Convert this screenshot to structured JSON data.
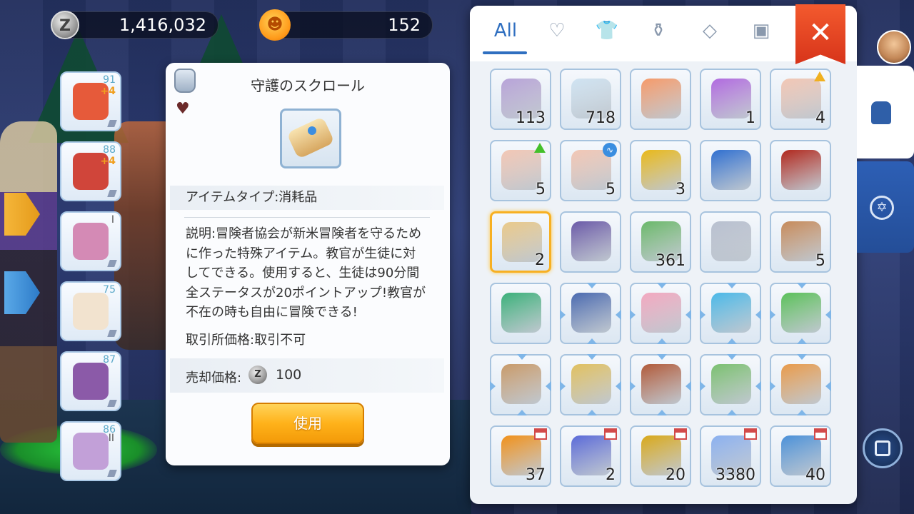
{
  "currency": {
    "zeny_icon": "Z",
    "zeny_amount": "1,416,032",
    "cat_amount": "152"
  },
  "equipment": [
    {
      "icon": "ring-icon",
      "num": "91",
      "plus": "+4",
      "color": "#e65a3a"
    },
    {
      "icon": "armor-icon",
      "num": "88",
      "plus": "+4",
      "color": "#d0453a"
    },
    {
      "icon": "gloves-icon",
      "num": "",
      "roman": "I",
      "color": "#d48ab5"
    },
    {
      "icon": "boots-icon",
      "num": "75",
      "color": "#f2e3cf"
    },
    {
      "icon": "gem-icon",
      "num": "87",
      "color": "#8b5aa8"
    },
    {
      "icon": "cape-icon",
      "num": "86",
      "roman": "II",
      "color": "#c2a0d8"
    }
  ],
  "detail": {
    "title": "守護のスクロール",
    "type_label": "アイテムタイプ:消耗品",
    "description": "説明:冒険者協会が新米冒険者を守るために作った特殊アイテム。教官が生徒に対してできる。使用すると、生徒は90分間全ステータスが20ポイントアップ!教官が不在の時も自由に冒険できる!",
    "trade_price": "取引所価格:取引不可",
    "sell_label": "売却価格:",
    "sell_coin": "Z",
    "sell_value": "100",
    "use_button": "使用"
  },
  "inventory": {
    "tabs": [
      {
        "label": "All",
        "icon": "all-tab"
      },
      {
        "label": "♡",
        "icon": "heart-icon"
      },
      {
        "label": "👕",
        "icon": "armor-tab-icon"
      },
      {
        "label": "⚱",
        "icon": "potion-tab-icon"
      },
      {
        "label": "◇",
        "icon": "diamond-icon"
      },
      {
        "label": "▣",
        "icon": "card-tab-icon"
      }
    ],
    "close_label": "✕",
    "rows": [
      [
        {
          "name": "butterfly-wing",
          "qty": "113",
          "color": "#b7a3d8"
        },
        {
          "name": "fly-wing",
          "qty": "718",
          "color": "#cfe3f2"
        },
        {
          "name": "potion-bottle",
          "qty": "",
          "color": "#f59a6a"
        },
        {
          "name": "purple-wing",
          "qty": "1",
          "color": "#b06ae0"
        },
        {
          "name": "chalice",
          "qty": "4",
          "color": "#f2c7b5",
          "badge": "tri"
        }
      ],
      [
        {
          "name": "chalice-green",
          "qty": "5",
          "color": "#f2c7b5",
          "badge": "tri-g"
        },
        {
          "name": "chalice-blue",
          "qty": "5",
          "color": "#f2c7b5",
          "badge": "circ"
        },
        {
          "name": "gold-card",
          "qty": "3",
          "color": "#e8b81a"
        },
        {
          "name": "blue-shield-card",
          "qty": "",
          "color": "#2f6fd0"
        },
        {
          "name": "red-card",
          "qty": "",
          "color": "#b0281e"
        }
      ],
      [
        {
          "name": "guardian-scroll",
          "qty": "2",
          "color": "#e9c98a",
          "selected": true
        },
        {
          "name": "purple-book",
          "qty": "",
          "color": "#6a5aa8"
        },
        {
          "name": "green-leaf",
          "qty": "361",
          "color": "#6ab86a"
        },
        {
          "name": "silver-sword-coin",
          "qty": "",
          "color": "#b8c0d0"
        },
        {
          "name": "pouch",
          "qty": "5",
          "color": "#c68a5a"
        }
      ],
      [
        {
          "name": "green-backpack",
          "qty": "",
          "color": "#3ab07a"
        },
        {
          "name": "blue-book",
          "qty": "",
          "color": "#4a6ab0",
          "arrows": true
        },
        {
          "name": "pink-box",
          "qty": "",
          "color": "#f2a8c0",
          "arrows": true
        },
        {
          "name": "orb-stand",
          "qty": "",
          "color": "#4ab8e8",
          "arrows": true
        },
        {
          "name": "green-card",
          "qty": "",
          "color": "#5ac05a",
          "arrows": true
        }
      ],
      [
        {
          "name": "open-book",
          "qty": "",
          "color": "#c89a6a",
          "arrows": true
        },
        {
          "name": "gold-pillar",
          "qty": "",
          "color": "#e0c060",
          "arrows": true
        },
        {
          "name": "red-diary",
          "qty": "",
          "color": "#b05a3a",
          "arrows": true
        },
        {
          "name": "mystery-box",
          "qty": "",
          "color": "#7ac070",
          "arrows": true
        },
        {
          "name": "orange-bag",
          "qty": "",
          "color": "#e89a4a",
          "arrows": true
        }
      ],
      [
        {
          "name": "maple-coin",
          "qty": "37",
          "color": "#f0901a",
          "badge": "shop"
        },
        {
          "name": "ticket",
          "qty": "2",
          "color": "#5a6ad8",
          "badge": "shop"
        },
        {
          "name": "gold-coin",
          "qty": "20",
          "color": "#d8a81a",
          "badge": "shop"
        },
        {
          "name": "crystal",
          "qty": "3380",
          "color": "#8ab0f0",
          "badge": "shop"
        },
        {
          "name": "medal",
          "qty": "40",
          "color": "#4a90d8",
          "badge": "shop"
        }
      ]
    ]
  }
}
